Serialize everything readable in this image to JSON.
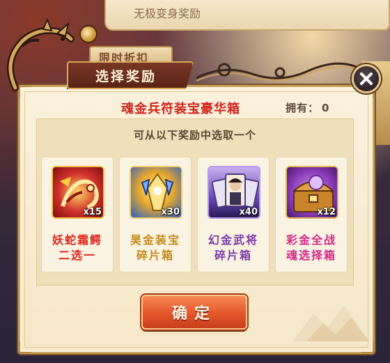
{
  "background": {
    "top_text": "无极变身奖励",
    "tab_behind_label": "限时折扣"
  },
  "dialog": {
    "title": "选择奖励",
    "chest_name": "魂金兵符装宝豪华箱",
    "owned_label": "拥有：",
    "owned_count": "0",
    "instruction": "可从以下奖励中选取一个",
    "confirm_label": "确定"
  },
  "rewards": [
    {
      "name_line1": "妖蛇霜鳄",
      "name_line2": "二选一",
      "quantity": "x15",
      "icon": "serpent-crocodile-icon",
      "name_color": "#e0241a"
    },
    {
      "name_line1": "昊金装宝",
      "name_line2": "碎片箱",
      "quantity": "x30",
      "icon": "golden-treasure-shard-icon",
      "name_color": "#c48a1c"
    },
    {
      "name_line1": "幻金武将",
      "name_line2": "碎片箱",
      "quantity": "x40",
      "icon": "hero-shard-cards-icon",
      "name_color": "#7a3aa8"
    },
    {
      "name_line1": "彩金全战",
      "name_line2": "魂选择箱",
      "quantity": "x12",
      "icon": "soul-chest-icon",
      "name_color": "#d2268a"
    }
  ],
  "colors": {
    "panel_bg": "#fbf1dc",
    "title_bg": "#7a3626",
    "confirm_bg": "#e4552a",
    "chest_name": "#d1231b"
  }
}
